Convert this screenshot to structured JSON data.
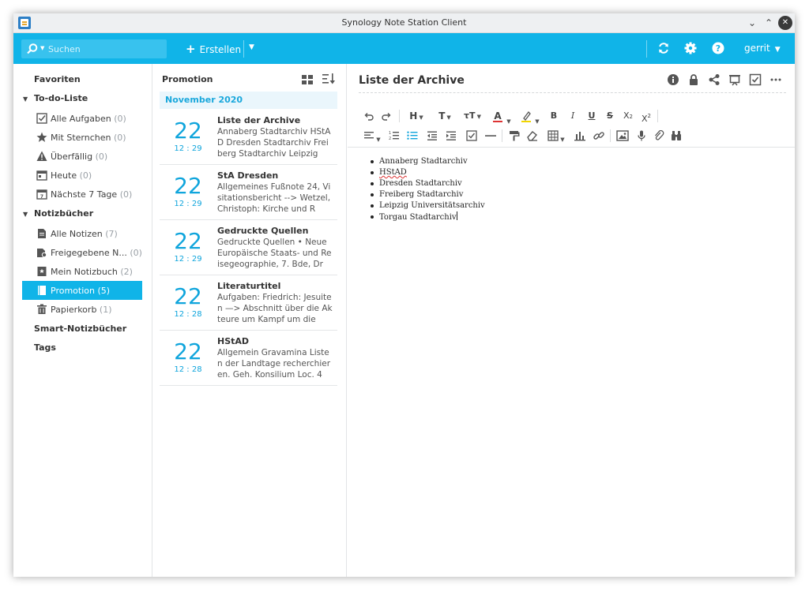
{
  "window": {
    "title": "Synology Note Station Client"
  },
  "toolbar": {
    "search_placeholder": "Suchen",
    "create_label": "Erstellen",
    "user": "gerrit",
    "accent": "#10b4e8"
  },
  "sidebar": {
    "favorites": "Favoriten",
    "todo_header": "To-do-Liste",
    "todo_items": [
      {
        "label": "Alle Aufgaben",
        "count": "(0)",
        "icon": "checkbox-icon"
      },
      {
        "label": "Mit Sternchen",
        "count": "(0)",
        "icon": "star-icon"
      },
      {
        "label": "Überfällig",
        "count": "(0)",
        "icon": "warning-icon"
      },
      {
        "label": "Heute",
        "count": "(0)",
        "icon": "calendar-icon"
      },
      {
        "label": "Nächste 7 Tage",
        "count": "(0)",
        "icon": "calendar-week-icon"
      }
    ],
    "notebooks_header": "Notizbücher",
    "notebook_items": [
      {
        "label": "Alle Notizen",
        "count": "(7)",
        "icon": "notes-icon"
      },
      {
        "label": "Freigegebene N...",
        "count": "(0)",
        "icon": "shared-notes-icon"
      },
      {
        "label": "Mein Notizbuch",
        "count": "(2)",
        "icon": "notebook-icon"
      },
      {
        "label": "Promotion",
        "count": "(5)",
        "icon": "notebook-icon"
      },
      {
        "label": "Papierkorb",
        "count": "(1)",
        "icon": "trash-icon"
      }
    ],
    "smart_notebooks": "Smart-Notizbücher",
    "tags": "Tags"
  },
  "notelist": {
    "title": "Promotion",
    "month": "November 2020",
    "notes": [
      {
        "day": "22",
        "time": "12 : 29",
        "title": "Liste der Archive",
        "snippet": "Annaberg Stadtarchiv HStAD Dresden Stadtarchiv Freiberg Stadtarchiv Leipzig"
      },
      {
        "day": "22",
        "time": "12 : 29",
        "title": "StA Dresden",
        "snippet": "Allgemeines Fußnote 24, Visitationsbericht --> Wetzel, Christoph: Kirche und R"
      },
      {
        "day": "22",
        "time": "12 : 29",
        "title": "Gedruckte Quellen",
        "snippet": "Gedruckte Quellen • Neue Europäische Staats- und Reisegeographie, 7. Bde, Dr"
      },
      {
        "day": "22",
        "time": "12 : 28",
        "title": "Literaturtitel",
        "snippet": "Aufgaben: Friedrich: Jesuiten —> Abschnitt über die Akteure um Kampf um die"
      },
      {
        "day": "22",
        "time": "12 : 28",
        "title": "HStAD",
        "snippet": "Allgemein Gravamina Liste n der Landtage recherchieren. Geh. Konsilium Loc. 4"
      }
    ]
  },
  "editor": {
    "title": "Liste der Archive",
    "content": [
      "Annaberg Stadtarchiv",
      "HStAD",
      "Dresden Stadtarchiv",
      "Freiberg Stadtarchiv",
      "Leipzig Universitätsarchiv",
      "Torgau Stadtarchiv"
    ],
    "toolbar": {
      "heading": "H",
      "text": "T",
      "bold": "B",
      "italic": "I",
      "underline": "U",
      "strike": "S"
    }
  }
}
